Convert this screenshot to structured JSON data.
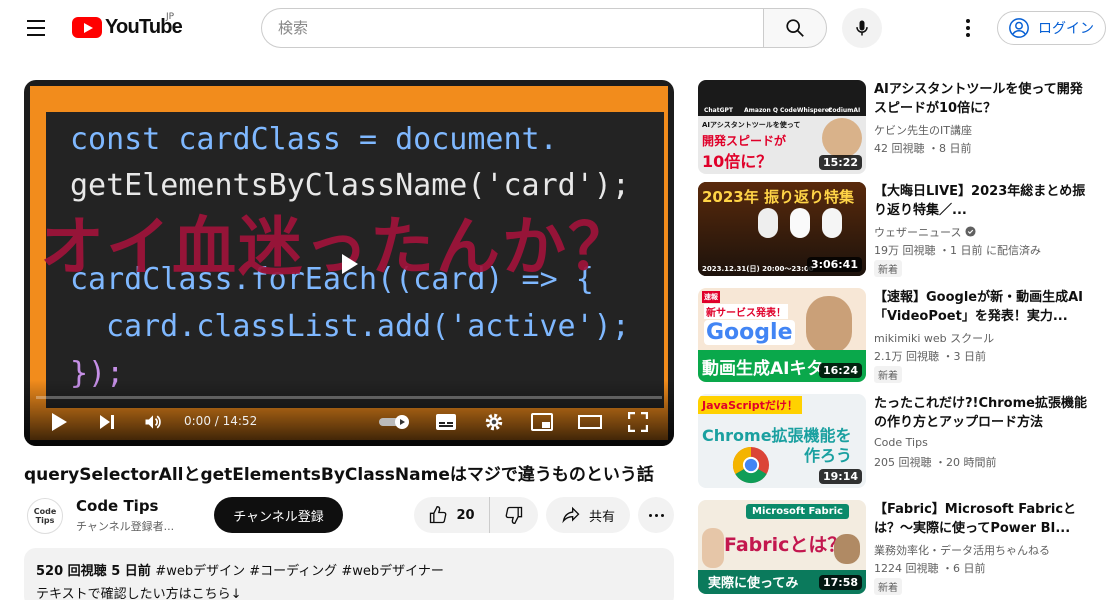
{
  "header": {
    "logo_text": "YouTube",
    "region": "JP",
    "search_placeholder": "検索",
    "login_label": "ログイン"
  },
  "player": {
    "code_line1": "const cardClass = document.",
    "code_line2": "getElementsByClassName('card');",
    "code_line4": "cardClass.forEach((card) => {",
    "code_line5": "card.classList.add('active');",
    "code_line6": "});",
    "overlay_text": "オイ血迷ったんか？",
    "time_display": "0:00 / 14:52",
    "progress": 0
  },
  "video": {
    "title": "querySelectorAllとgetElementsByClassNameはマジで違うものという話",
    "channel_name": "Code Tips",
    "channel_avatar_text": "Code Tips",
    "subscribers": "チャンネル登録者...",
    "subscribe_label": "チャンネル登録",
    "likes": "20",
    "share_label": "共有",
    "views_date": "520 回視聴  5 日前",
    "hashtags": "#webデザイン #コーディング #webデザイナー",
    "description": "テキストで確認したい方はこちら↓"
  },
  "recommendations": [
    {
      "title": "AIアシスタントツールを使って開発スピードが10倍に？",
      "channel": "ケビン先生のIT講座",
      "meta": "42 回視聴 ・8 日前",
      "duration": "15:22",
      "badge": "",
      "thumb_text1": "AIアシスタントツールを使って",
      "thumb_text2": "開発スピードが",
      "thumb_text3": "10倍に？",
      "thumb_logos": [
        "ChatGPT",
        "Amazon Q",
        "CodeWhisperer",
        "CodiumAI"
      ]
    },
    {
      "title": "【大晦日LIVE】2023年総まとめ振り返り特集／...",
      "channel": "ウェザーニュース",
      "meta": "19万 回視聴 ・1 日前 に配信済み",
      "duration": "3:06:41",
      "badge": "新着",
      "thumb_text1": "2023年 振り返り特集",
      "thumb_text2": "2023.12.31(日) 20:00～23:00"
    },
    {
      "title": "【速報】Googleが新・動画生成AI「VideoPoet」を発表！実力...",
      "channel": "mikimiki web スクール",
      "meta": "2.1万 回視聴 ・3 日前",
      "duration": "16:24",
      "badge": "新着",
      "thumb_text1": "速報",
      "thumb_text2": "新サービス発表！",
      "thumb_text3": "Google",
      "thumb_text4": "動画生成AIキタ"
    },
    {
      "title": "たったこれだけ?!Chrome拡張機能の作り方とアップロード方法",
      "channel": "Code Tips",
      "meta": "205 回視聴 ・20 時間前",
      "duration": "19:14",
      "badge": "",
      "thumb_text1": "JavaScriptだけ！",
      "thumb_text2": "Chrome拡張機能を",
      "thumb_text3": "作ろう"
    },
    {
      "title": "【Fabric】Microsoft Fabricとは？～実際に使ってPower BI...",
      "channel": "業務効率化・データ活用ちゃんねる",
      "meta": "1224 回視聴 ・6 日前",
      "duration": "17:58",
      "badge": "新着",
      "thumb_text1": "Microsoft Fabric",
      "thumb_text2": "Fabricとは？",
      "thumb_text3": "実際に使ってみ"
    }
  ],
  "colors": {
    "brand_red": "#ff0000",
    "link_blue": "#065fd4",
    "player_border": "#f28c1c",
    "overlay_text": "#a0133a"
  }
}
